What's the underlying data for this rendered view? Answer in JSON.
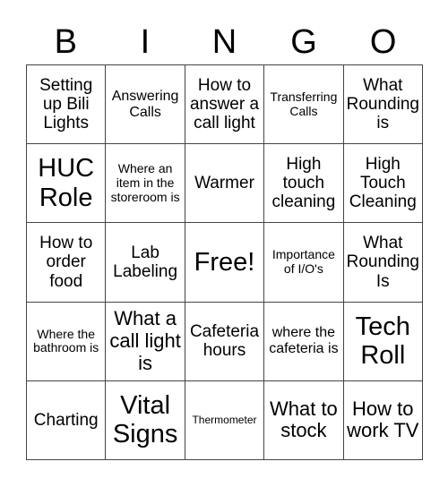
{
  "header": {
    "letters": [
      "B",
      "I",
      "N",
      "G",
      "O"
    ]
  },
  "card": {
    "rows": [
      [
        {
          "text": "Setting up Bili Lights",
          "size": "lg"
        },
        {
          "text": "Answering Calls",
          "size": "md"
        },
        {
          "text": "How to answer a call light",
          "size": "lg"
        },
        {
          "text": "Transferring Calls",
          "size": "sm"
        },
        {
          "text": "What Rounding is",
          "size": "lg"
        }
      ],
      [
        {
          "text": "HUC Role",
          "size": "xxl"
        },
        {
          "text": "Where an item in the storeroom is",
          "size": "sm"
        },
        {
          "text": "Warmer",
          "size": "lg"
        },
        {
          "text": "High touch cleaning",
          "size": "lg"
        },
        {
          "text": "High Touch Cleaning",
          "size": "lg"
        }
      ],
      [
        {
          "text": "How to order food",
          "size": "lg"
        },
        {
          "text": "Lab Labeling",
          "size": "lg"
        },
        {
          "text": "Free!",
          "size": "free",
          "free": true
        },
        {
          "text": "Importance of I/O's",
          "size": "sm"
        },
        {
          "text": "What Rounding Is",
          "size": "lg"
        }
      ],
      [
        {
          "text": "Where the bathroom is",
          "size": "sm"
        },
        {
          "text": "What a call light is",
          "size": "xl"
        },
        {
          "text": "Cafeteria hours",
          "size": "lg"
        },
        {
          "text": "where the cafeteria is",
          "size": "md"
        },
        {
          "text": "Tech Roll",
          "size": "xxl"
        }
      ],
      [
        {
          "text": "Charting",
          "size": "lg"
        },
        {
          "text": "Vital Signs",
          "size": "xxl"
        },
        {
          "text": "Thermometer",
          "size": "xs"
        },
        {
          "text": "What to stock",
          "size": "xl"
        },
        {
          "text": "How to work TV",
          "size": "xl"
        }
      ]
    ]
  }
}
